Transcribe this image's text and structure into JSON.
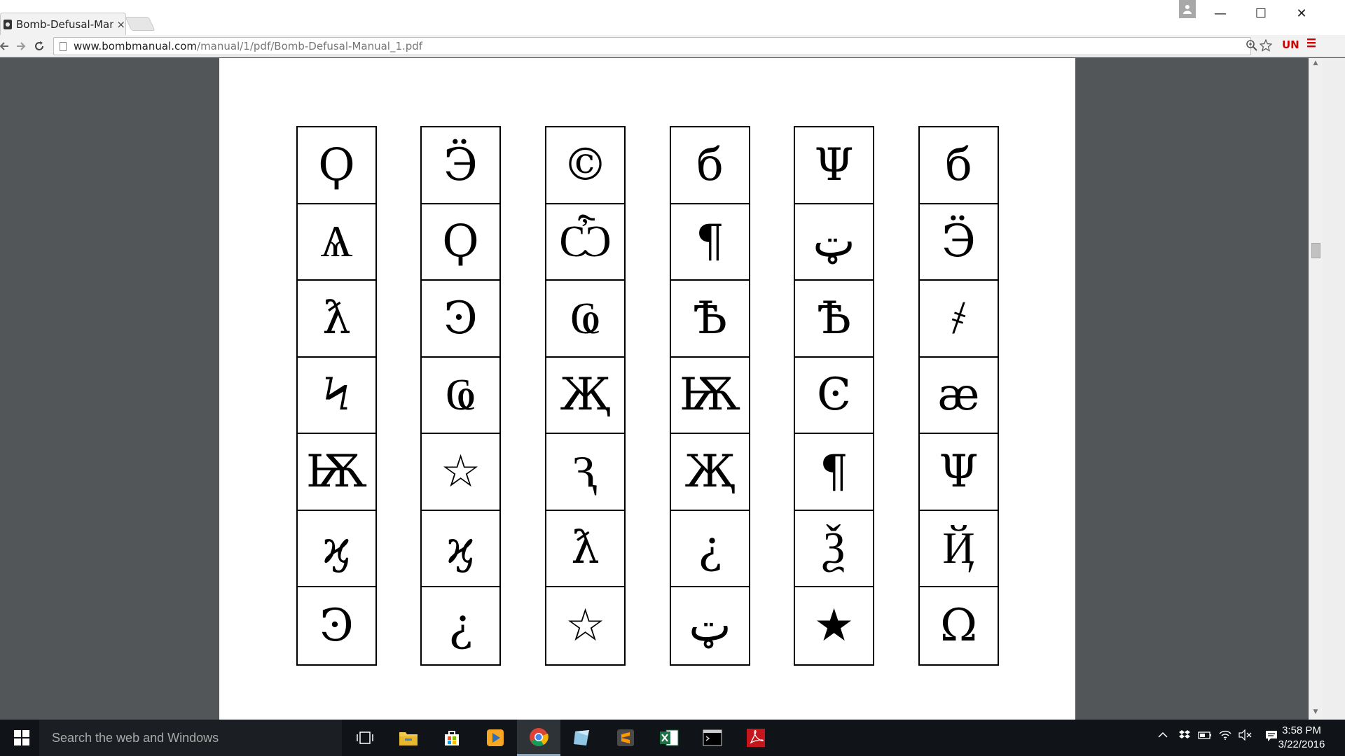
{
  "browser": {
    "tab_title": "Bomb-Defusal-Manu",
    "tab_close": "×",
    "url_host": "www.bombmanual.com",
    "url_path": "/manual/1/pdf/Bomb-Defusal-Manual_1.pdf",
    "extension_label": "UN"
  },
  "window_controls": {
    "minimize": "—",
    "maximize": "☐",
    "close": "✕"
  },
  "symbol_columns": [
    [
      "Ϙ",
      "Ѧ",
      "ƛ",
      "Ϟ",
      "Ѭ",
      "ϗ",
      "Ͽ"
    ],
    [
      "Ӭ",
      "Ϙ",
      "Ͽ",
      "Ҩ",
      "☆",
      "ϗ",
      "¿"
    ],
    [
      "©",
      "Ѽ",
      "Ҩ",
      "Җ",
      "Ԇ",
      "ƛ",
      "☆"
    ],
    [
      "б",
      "¶",
      "Ѣ",
      "Ѭ",
      "Җ",
      "¿",
      "ټ"
    ],
    [
      "Ψ",
      "ټ",
      "Ѣ",
      "Ͼ",
      "¶",
      "Ѯ",
      "★"
    ],
    [
      "б",
      "Ӭ",
      "҂",
      "æ",
      "Ψ",
      "Ҋ",
      "Ω"
    ]
  ],
  "taskbar": {
    "search_placeholder": "Search the web and Windows",
    "time": "3:58 PM",
    "date": "3/22/2016"
  },
  "colors": {
    "viewer_bg": "#525659",
    "taskbar_bg": "#101418",
    "extension_red": "#cc0000"
  },
  "icons": {
    "taskbar": [
      "task-view-icon",
      "file-explorer-icon",
      "store-icon",
      "media-player-icon",
      "chrome-icon",
      "app-icon",
      "sublime-text-icon",
      "excel-icon",
      "command-prompt-icon",
      "acrobat-icon"
    ]
  }
}
